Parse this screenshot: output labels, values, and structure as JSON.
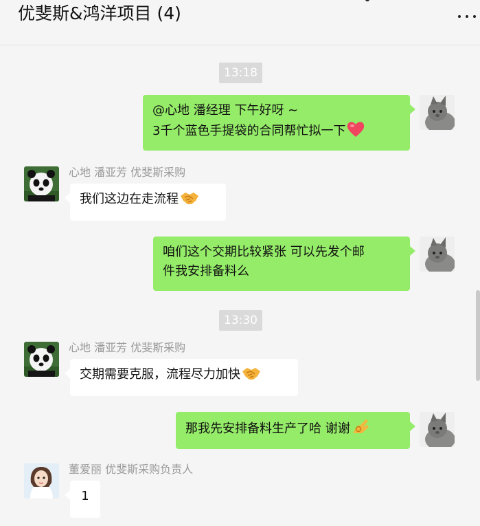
{
  "header": {
    "title": "优斐斯&鸿洋项目 (4)"
  },
  "messages": [
    {
      "type": "time",
      "text": "13:18"
    },
    {
      "type": "out",
      "lines": [
        "@心地 潘经理 下午好呀 ~",
        "3千个蓝色手提袋的合同帮忙拟一下"
      ],
      "emoji": "heart-emoji"
    },
    {
      "type": "in",
      "sender": "心地 潘亚芳 优斐斯采购",
      "lines": [
        "我们这边在走流程"
      ],
      "emoji": "handshake-emoji",
      "avatar": "panda-avatar"
    },
    {
      "type": "out",
      "lines": [
        "咱们这个交期比较紧张 可以先发个邮",
        "件我安排备料么"
      ]
    },
    {
      "type": "time",
      "text": "13:30"
    },
    {
      "type": "in",
      "sender": "心地 潘亚芳 优斐斯采购",
      "lines": [
        "交期需要克服，流程尽力加快"
      ],
      "emoji": "handshake-emoji",
      "avatar": "panda-avatar"
    },
    {
      "type": "out",
      "lines": [
        "那我先安排备料生产了哈 谢谢"
      ],
      "emoji": "ok-hand-emoji"
    },
    {
      "type": "in",
      "sender": "董爱丽 优斐斯采购负责人",
      "lines": [
        "1"
      ],
      "avatar": "woman-avatar"
    }
  ],
  "colors": {
    "out_bubble": "#95ec69",
    "in_bubble": "#ffffff",
    "background": "#f5f5f5",
    "time_badge": "#dadada"
  }
}
